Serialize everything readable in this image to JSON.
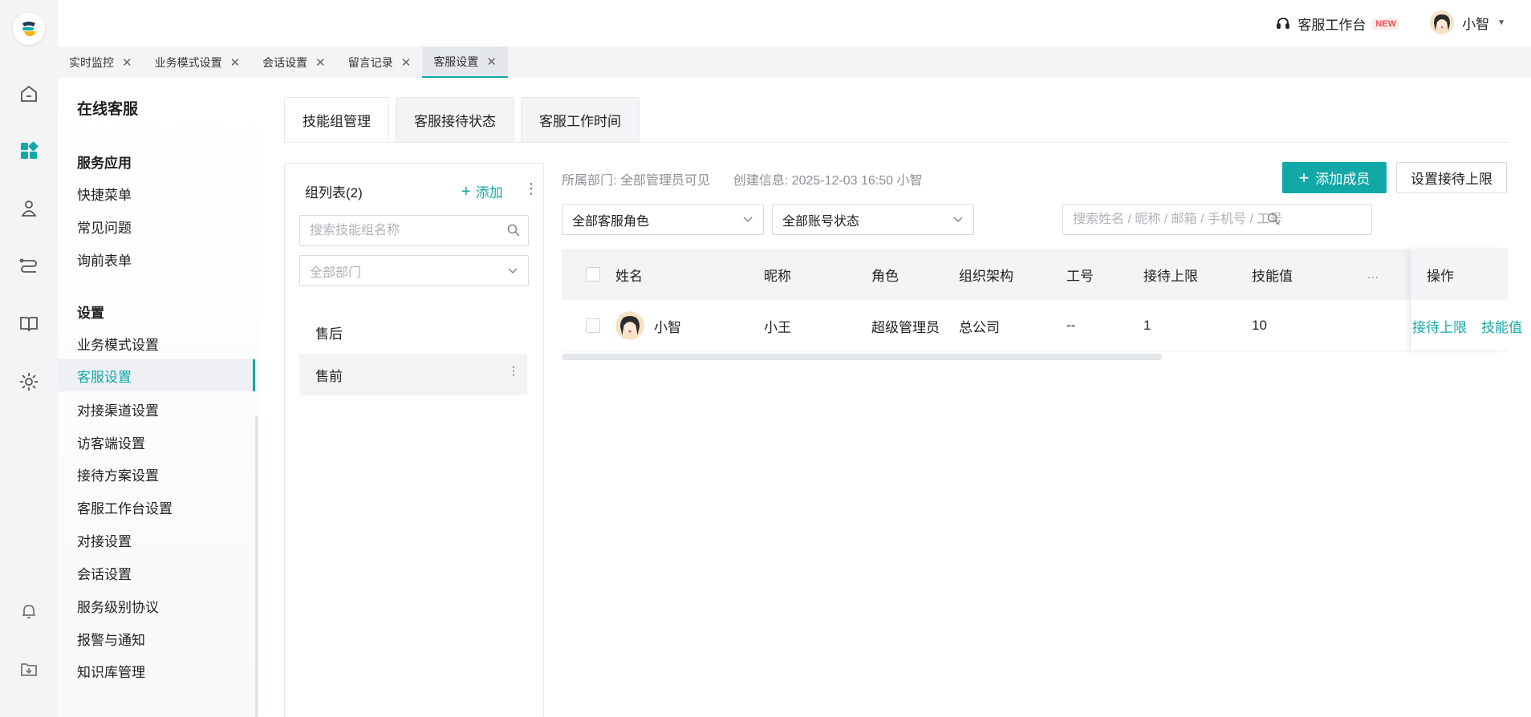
{
  "header": {
    "workbench_label": "客服工作台",
    "new_badge": "NEW",
    "user_name": "小智"
  },
  "tabs": [
    {
      "label": "实时监控"
    },
    {
      "label": "业务模式设置"
    },
    {
      "label": "会话设置"
    },
    {
      "label": "留言记录"
    },
    {
      "label": "客服设置",
      "active": true
    }
  ],
  "sidebar": {
    "title": "在线客服",
    "groups": [
      {
        "title": "服务应用",
        "items": [
          "快捷菜单",
          "常见问题",
          "询前表单"
        ]
      },
      {
        "title": "设置",
        "items": [
          "业务模式设置",
          "客服设置",
          "对接渠道设置",
          "访客端设置",
          "接待方案设置",
          "客服工作台设置",
          "对接设置",
          "会话设置",
          "服务级别协议",
          "报警与通知",
          "知识库管理"
        ]
      }
    ],
    "active_item": "客服设置"
  },
  "main_tabs": [
    {
      "label": "技能组管理",
      "active": true
    },
    {
      "label": "客服接待状态"
    },
    {
      "label": "客服工作时间"
    }
  ],
  "group_panel": {
    "title": "组列表(2)",
    "add_label": "添加",
    "search_placeholder": "搜索技能组名称",
    "dept_placeholder": "全部部门",
    "groups": [
      "售后",
      "售前"
    ],
    "selected": "售前"
  },
  "info": {
    "dept": "所属部门: 全部管理员可见",
    "created": "创建信息: 2025-12-03 16:50  小智"
  },
  "actions": {
    "add_member": "添加成员",
    "set_limit": "设置接待上限"
  },
  "filters": {
    "role": "全部客服角色",
    "status": "全部账号状态",
    "search_placeholder": "搜索姓名 / 昵称 / 邮箱 / 手机号 / 工号"
  },
  "table": {
    "columns": [
      "姓名",
      "昵称",
      "角色",
      "组织架构",
      "工号",
      "接待上限",
      "技能值",
      "操作"
    ],
    "rows": [
      {
        "name": "小智",
        "nickname": "小王",
        "role": "超级管理员",
        "org": "总公司",
        "job_no": "--",
        "limit": "1",
        "skill": "10"
      }
    ],
    "row_actions": [
      "接待上限",
      "技能值",
      "···"
    ]
  },
  "colors": {
    "accent": "#13a8a8",
    "new_badge": "#f04e4e"
  }
}
